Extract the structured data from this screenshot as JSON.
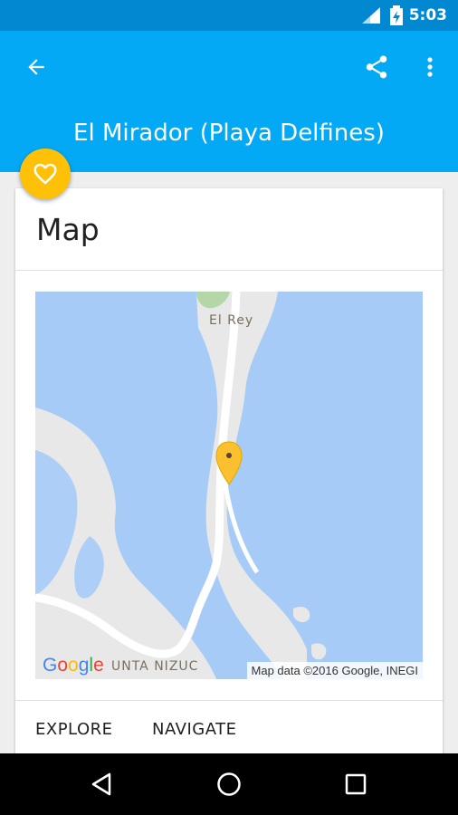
{
  "status_bar": {
    "time": "5:03",
    "bg_color": "#0288d1"
  },
  "app_bar": {
    "title": "El Mirador (Playa Delfines)",
    "bg_color": "#03a9f4",
    "back_icon": "arrow-back-icon",
    "share_icon": "share-icon",
    "overflow_icon": "more-vert-icon"
  },
  "fab": {
    "icon": "heart-outline-icon",
    "color": "#ffc107"
  },
  "card": {
    "title": "Map",
    "map": {
      "place_labels": [
        "El Rey",
        "UNTA NIZUC"
      ],
      "google_logo": "Google",
      "attribution": "Map data ©2016 Google, INEGI",
      "marker_color": "#fbc02d",
      "water_color": "#a6cbf7",
      "land_color": "#e8e8e8"
    },
    "actions": [
      {
        "label": "EXPLORE"
      },
      {
        "label": "NAVIGATE"
      }
    ]
  },
  "nav_bar": {
    "back": "back-triangle-icon",
    "home": "home-circle-icon",
    "recents": "recents-square-icon"
  }
}
